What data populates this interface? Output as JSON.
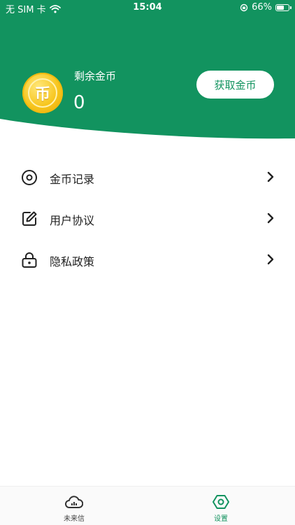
{
  "status_bar": {
    "carrier": "无 SIM 卡",
    "time": "15:04",
    "battery": "66%",
    "battery_level": 0.66
  },
  "colors": {
    "accent": "#12935f",
    "coin_gold": "#f7c51c"
  },
  "header": {
    "coin_glyph": "币",
    "coin_label": "剩余金币",
    "coin_value": "0",
    "get_coins_label": "获取金币"
  },
  "menu": {
    "items": [
      {
        "label": "金币记录",
        "icon": "target-circle-icon"
      },
      {
        "label": "用户协议",
        "icon": "edit-icon"
      },
      {
        "label": "隐私政策",
        "icon": "lock-icon"
      }
    ]
  },
  "tabbar": {
    "tabs": [
      {
        "label": "未来信",
        "icon": "cloud-chart-icon",
        "active": false
      },
      {
        "label": "设置",
        "icon": "settings-hexagon-icon",
        "active": true
      }
    ]
  }
}
